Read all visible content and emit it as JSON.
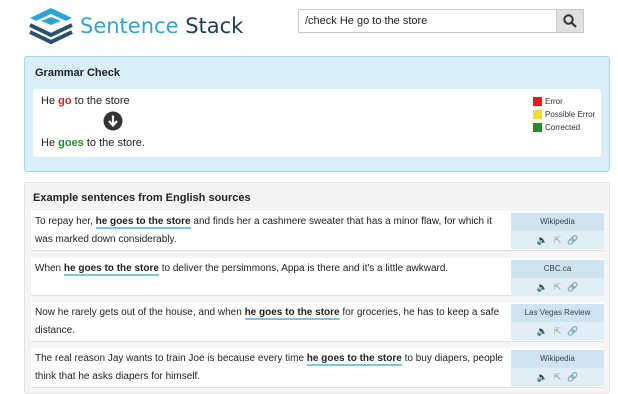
{
  "header": {
    "brand_word1": "Sentence",
    "brand_word2": "Stack",
    "search_value": "/check He go to the store"
  },
  "grammar": {
    "title": "Grammar Check",
    "orig_before": "He ",
    "orig_error": "go",
    "orig_after": " to the store",
    "corr_before": "He ",
    "corr_fixed": "goes",
    "corr_after": " to the store.",
    "legend": [
      {
        "label": "Error",
        "color": "#e01b1b"
      },
      {
        "label": "Possible Error",
        "color": "#e8e03a"
      },
      {
        "label": "Corrected",
        "color": "#2a8a2a"
      }
    ]
  },
  "examples": {
    "title": "Example sentences from English sources",
    "rows": [
      {
        "before": "To repay her, ",
        "highlight": "he goes to the store",
        "after": " and finds her a cashmere sweater that has a minor flaw, for which it was marked down considerably.",
        "source": "Wikipedia"
      },
      {
        "before": "When ",
        "highlight": "he goes to the store",
        "after": " to deliver the persimmons, Appa is there and it's a little awkward.",
        "source": "CBC.ca"
      },
      {
        "before": "Now he rarely gets out of the house, and when ",
        "highlight": "he goes to the store",
        "after": " for groceries, he has to keep a safe distance.",
        "source": "Las Vegas Review"
      },
      {
        "before": "The real reason Jay wants to train Joe is because every time ",
        "highlight": "he goes to the store",
        "after": " to buy diapers, people think that he asks diapers for himself.",
        "source": "Wikipedia"
      }
    ]
  }
}
